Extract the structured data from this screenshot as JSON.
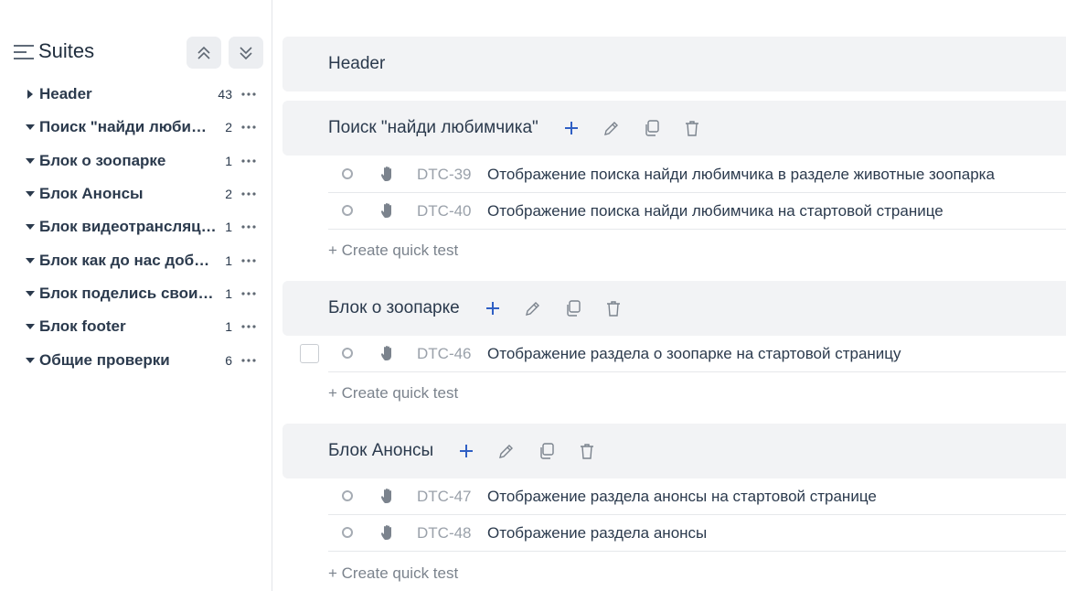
{
  "sidebar": {
    "title": "Suites",
    "suites": [
      {
        "name": "Header",
        "count": "43",
        "expanded": false
      },
      {
        "name": "Поиск \"найди любимчика\"",
        "count": "2",
        "expanded": true
      },
      {
        "name": "Блок о зоопарке",
        "count": "1",
        "expanded": true
      },
      {
        "name": "Блок Анонсы",
        "count": "2",
        "expanded": true
      },
      {
        "name": "Блок видеотрансляция",
        "count": "1",
        "expanded": true
      },
      {
        "name": "Блок как до нас добраться",
        "count": "1",
        "expanded": true
      },
      {
        "name": "Блок поделись своими впечатлениями",
        "count": "1",
        "expanded": true
      },
      {
        "name": "Блок footer",
        "count": "1",
        "expanded": true
      },
      {
        "name": "Общие проверки",
        "count": "6",
        "expanded": true
      }
    ]
  },
  "main": {
    "quick_test_label": "+ Create quick test",
    "sections": [
      {
        "title": "Header",
        "cases": []
      },
      {
        "title": "Поиск \"найди любимчика\"",
        "cases": [
          {
            "id": "DTC-39",
            "title": "Отображение поиска найди любимчика в разделе животные зоопарка"
          },
          {
            "id": "DTC-40",
            "title": "Отображение поиска найди любимчика на стартовой странице"
          }
        ]
      },
      {
        "title": "Блок о зоопарке",
        "cases": [
          {
            "id": "DTC-46",
            "title": "Отображение раздела о зоопарке на стартовой страницу"
          }
        ]
      },
      {
        "title": "Блок Анонсы",
        "cases": [
          {
            "id": "DTC-47",
            "title": "Отображение раздела анонсы на стартовой странице"
          },
          {
            "id": "DTC-48",
            "title": "Отображение раздела анонсы"
          }
        ]
      }
    ]
  },
  "colors": {
    "accent": "#2f5fc4",
    "text": "#2b3a4d",
    "muted": "#9aa1aa",
    "section_bg": "#f2f3f5"
  }
}
